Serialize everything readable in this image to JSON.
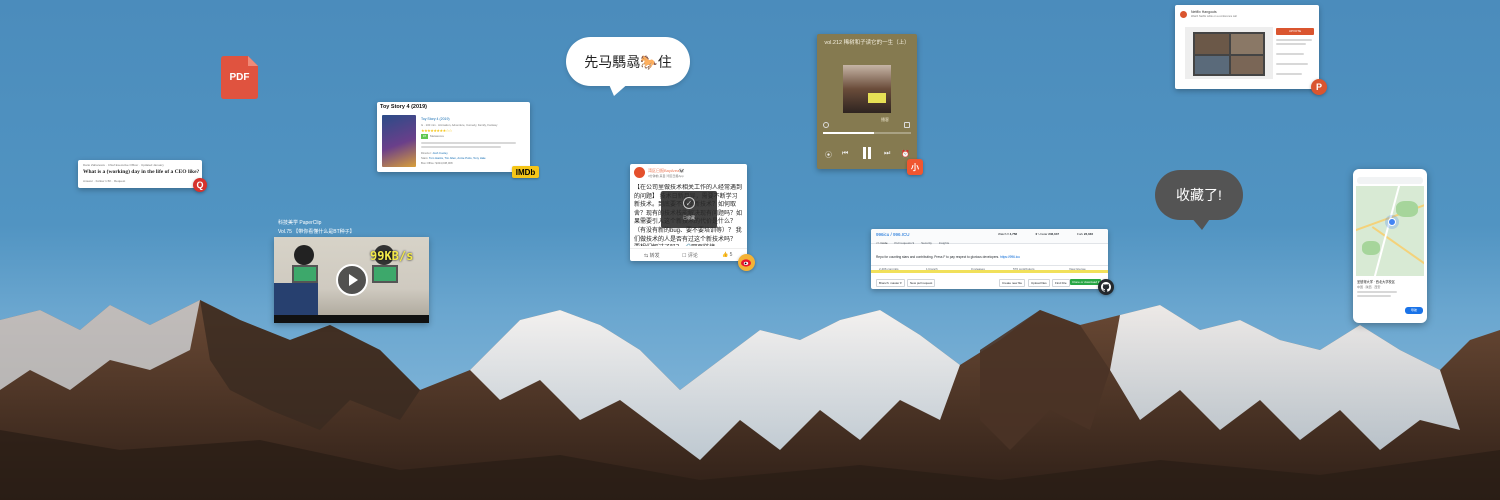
{
  "pdf_file": {
    "label": "PDF",
    "color": "#e0533f"
  },
  "quora_card": {
    "meta": "Dario Zaharescu · Chief Executive Officer · Updated January",
    "title": "What is a (working) day in the life of a CEO like?",
    "actions": "Answer · Follow 1.5K · Request",
    "badge": "Q",
    "badge_color": "#d6322d"
  },
  "imdb_card": {
    "title": "Toy Story 4 (2019)",
    "subtitle": "Toy Story 4 (2019)",
    "meta": "G · 100 min · Animation, Adventure, Comedy, Family, Fantasy",
    "score": "97",
    "score_label": "Metascore",
    "director_label": "Director:",
    "director": "Josh Cooley",
    "stars_label": "Stars:",
    "stars": "Tom Hanks, Tim Allen, Annie Potts, Tony Hale",
    "box_office_label": "Box Office:",
    "box_office": "$434,038,008",
    "badge": "IMDb",
    "badge_color": "#f5c518"
  },
  "video_card": {
    "caption_line1": "科技美学 PaperClip",
    "caption_line2": "Vol.75 【带你看懂什么是BT种子】",
    "overlay_text": "99KB/s",
    "play_icon": "play-icon"
  },
  "speech_bubble_1": {
    "text": "先马騳骉🐎住"
  },
  "weibo_card": {
    "username": "湾区日报BayArea🐼",
    "meta": "3分钟前 来自 湾区日报App",
    "body": "【在公司里做技术相关工作的人经常遇到的问题】 技术日新月异，需要不断学习新技术。到底要不要学新技术？如何取舍？现有的技术栈能解决现有问题吗？如果需要引入这个新技术的代价是什么？（有没有新的bug、要不要培训等）？ 我们做技术的人是否有过这个新技术吗？ 要想们解过了吗？ 🔗网页链接",
    "toast_label": "已收藏",
    "repost_label": "转发",
    "comment_label": "评论",
    "like_count": "5",
    "badge_icon": "weibo-icon",
    "badge_color": "#f3b236"
  },
  "podcast_card": {
    "title": "vol.212 稀树和子读它的一生（上）",
    "progress": 0.58,
    "tag": "播客",
    "badge": "小",
    "badge_color": "#f0562f",
    "bg_color": "#857a50"
  },
  "producthunt_card": {
    "title": "Netflix Hangouts",
    "subtitle": "Watch Netflix while on a conference call",
    "upvote": "UPVOTE",
    "badge": "P",
    "badge_color": "#da552f"
  },
  "speech_bubble_2": {
    "text": "收藏了!"
  },
  "github_card": {
    "repo": "996icu / 996.ICU",
    "watch": "Watch ▾",
    "watch_count": "4,758",
    "star": "★ Unstar",
    "star_count": "246,047",
    "fork": "Fork",
    "fork_count": "22,046",
    "tabs": [
      "<> Code",
      "Pull requests 9",
      "Security",
      "Insights"
    ],
    "description": "Repo for counting stars and contributing. Press F to pay respect to glorious developers.",
    "link": "https://996.icu",
    "stats": [
      "2,406 commits",
      "1 branch",
      "0 releases",
      "576 contributors",
      "View license"
    ],
    "branch_button": "Branch: master ▾",
    "new_pr_button": "New pull request",
    "create_file": "Create new file",
    "upload_files": "Upload files",
    "find_file": "Find File",
    "clone_button": "Clone or download ▾",
    "badge_icon": "github-icon",
    "badge_color": "#24292e"
  },
  "maps_card": {
    "place_title": "圣彼得大学 · 西北大学校区",
    "place_sub": "中国 · 陕西 · 西安",
    "button_label": "导航"
  }
}
